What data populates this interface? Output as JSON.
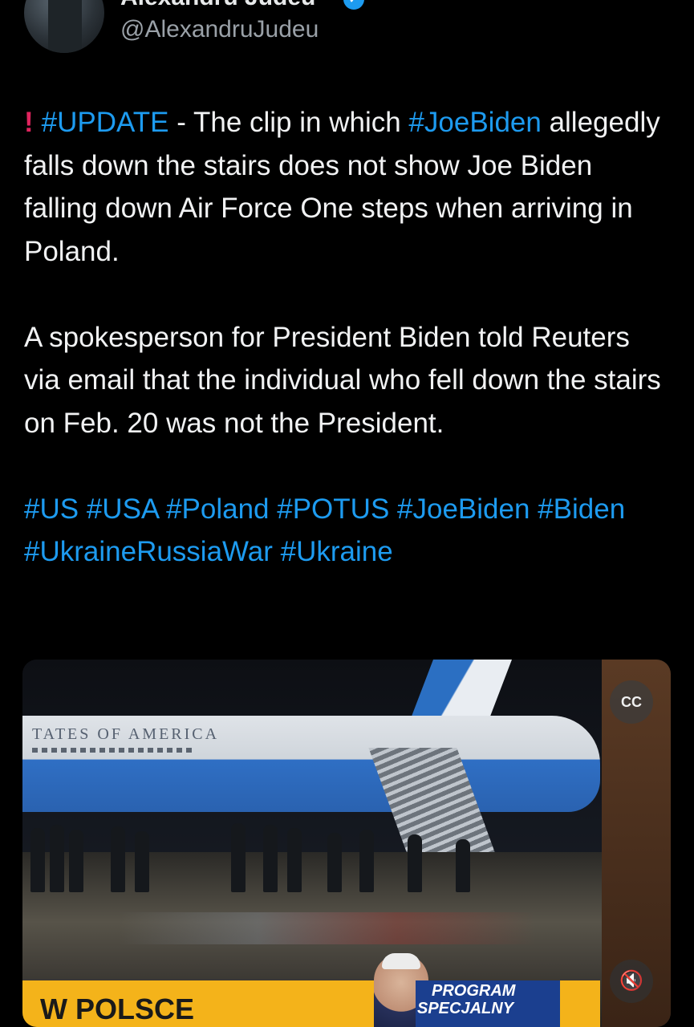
{
  "author": {
    "display_name": "Alexandru Judeu",
    "handle": "@AlexandruJudeu",
    "verified_icon": "verified-badge-icon"
  },
  "tweet": {
    "update_tag": "#UPDATE",
    "update_rest": " - The clip in which ",
    "joebiden_tag": "#JoeBiden",
    "para1_rest": " allegedly falls down the stairs does not show Joe Biden falling down Air Force One steps when arriving in Poland.",
    "para2": "A spokesperson for President Biden told Reuters via email that the individual who fell down the stairs on Feb. 20 was not the President.",
    "hashtags": [
      "#US",
      "#USA",
      "#Poland",
      "#POTUS",
      "#JoeBiden",
      "#Biden",
      "#UkraineRussiaWar",
      "#Ukraine"
    ]
  },
  "media": {
    "plane_text": "TATES OF AMERICA",
    "lower_third_label": "W POLSCE",
    "program_line1": "PROGRAM",
    "program_line2": "SPECJALNY",
    "captions_icon": "captions-off-icon",
    "mute_icon": "volume-muted-icon",
    "cc_glyph": "CC",
    "mute_glyph": "🔇"
  },
  "colors": {
    "background": "#000000",
    "text": "#e7e9ea",
    "link": "#1d9bf0",
    "alert": "#e0245e"
  }
}
